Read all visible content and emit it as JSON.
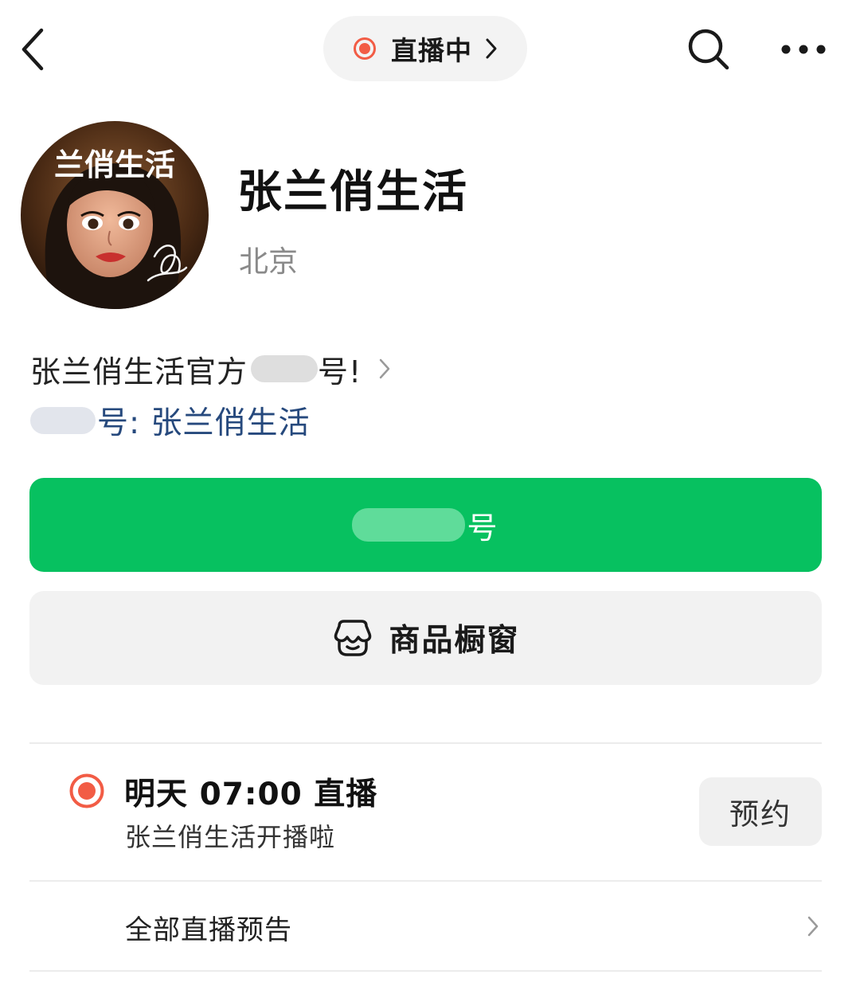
{
  "topbar": {
    "live_status": "直播中"
  },
  "profile": {
    "avatar_text": "兰俏生活",
    "name": "张兰俏生活",
    "location": "北京"
  },
  "bio": {
    "prefix": "张兰俏生活官方",
    "suffix": "号!"
  },
  "wechat_link": {
    "suffix": "号: 张兰俏生活"
  },
  "actions": {
    "follow_label": "号",
    "shop_label": "商品橱窗"
  },
  "live_preview": {
    "title": "明天 07:00 直播",
    "subtitle": "张兰俏生活开播啦",
    "reserve_label": "预约"
  },
  "all_previews_label": "全部直播预告",
  "colors": {
    "brand_green": "#07c160",
    "live_red": "#f25c45",
    "link_blue": "#26497d"
  }
}
